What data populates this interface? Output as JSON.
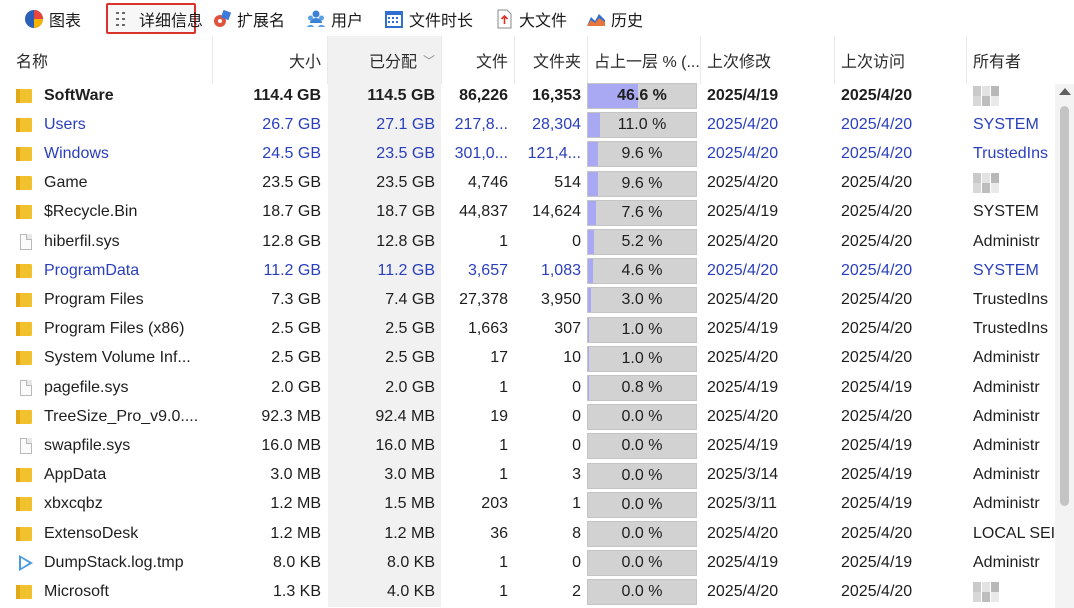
{
  "toolbar": {
    "tabs": [
      {
        "label": "图表",
        "icon": "pie-chart-icon",
        "active": false
      },
      {
        "label": "详细信息",
        "icon": "details-list-icon",
        "active": true
      },
      {
        "label": "扩展名",
        "icon": "extensions-icon",
        "active": false
      },
      {
        "label": "用户",
        "icon": "users-icon",
        "active": false
      },
      {
        "label": "文件时长",
        "icon": "calendar-icon",
        "active": false
      },
      {
        "label": "大文件",
        "icon": "big-file-icon",
        "active": false
      },
      {
        "label": "历史",
        "icon": "history-chart-icon",
        "active": false
      }
    ],
    "active_outline_color": "#d9342b"
  },
  "table": {
    "columns": {
      "name": "名称",
      "size": "大小",
      "allocated": "已分配",
      "files": "文件",
      "folders": "文件夹",
      "percent": "占上一层 % (...",
      "modified": "上次修改",
      "accessed": "上次访问",
      "owner": "所有者"
    },
    "sort_column": "allocated",
    "sort_indicator": "chevron-down-icon",
    "colors": {
      "blue_text": "#2a3fbd",
      "bar_fill": "#a9a9f3",
      "bar_track": "#d2d2d2"
    },
    "rows": [
      {
        "name": "SoftWare",
        "icon": "folder-icon",
        "size": "114.4 GB",
        "allocated": "114.5 GB",
        "files": "86,226",
        "folders": "16,353",
        "percent_text": "46.6 %",
        "percent": 46.6,
        "modified": "2025/4/19",
        "accessed": "2025/4/20",
        "owner": "",
        "owner_blurred": true,
        "bold": true,
        "blue": false
      },
      {
        "name": "Users",
        "icon": "folder-icon",
        "size": "26.7 GB",
        "allocated": "27.1 GB",
        "files": "217,8...",
        "folders": "28,304",
        "percent_text": "11.0 %",
        "percent": 11.0,
        "modified": "2025/4/20",
        "accessed": "2025/4/20",
        "owner": "SYSTEM",
        "owner_blurred": false,
        "bold": false,
        "blue": true
      },
      {
        "name": "Windows",
        "icon": "folder-icon",
        "size": "24.5 GB",
        "allocated": "23.5 GB",
        "files": "301,0...",
        "folders": "121,4...",
        "percent_text": "9.6 %",
        "percent": 9.6,
        "modified": "2025/4/20",
        "accessed": "2025/4/20",
        "owner": "TrustedIns",
        "owner_blurred": false,
        "bold": false,
        "blue": true
      },
      {
        "name": "Game",
        "icon": "folder-icon",
        "size": "23.5 GB",
        "allocated": "23.5 GB",
        "files": "4,746",
        "folders": "514",
        "percent_text": "9.6 %",
        "percent": 9.6,
        "modified": "2025/4/20",
        "accessed": "2025/4/20",
        "owner": "",
        "owner_blurred": true,
        "bold": false,
        "blue": false
      },
      {
        "name": "$Recycle.Bin",
        "icon": "folder-icon",
        "size": "18.7 GB",
        "allocated": "18.7 GB",
        "files": "44,837",
        "folders": "14,624",
        "percent_text": "7.6 %",
        "percent": 7.6,
        "modified": "2025/4/19",
        "accessed": "2025/4/20",
        "owner": "SYSTEM",
        "owner_blurred": false,
        "bold": false,
        "blue": false
      },
      {
        "name": "hiberfil.sys",
        "icon": "file-icon",
        "size": "12.8 GB",
        "allocated": "12.8 GB",
        "files": "1",
        "folders": "0",
        "percent_text": "5.2 %",
        "percent": 5.2,
        "modified": "2025/4/20",
        "accessed": "2025/4/20",
        "owner": "Administr",
        "owner_blurred": false,
        "bold": false,
        "blue": false
      },
      {
        "name": "ProgramData",
        "icon": "folder-icon",
        "size": "11.2 GB",
        "allocated": "11.2 GB",
        "files": "3,657",
        "folders": "1,083",
        "percent_text": "4.6 %",
        "percent": 4.6,
        "modified": "2025/4/20",
        "accessed": "2025/4/20",
        "owner": "SYSTEM",
        "owner_blurred": false,
        "bold": false,
        "blue": true
      },
      {
        "name": "Program Files",
        "icon": "folder-icon",
        "size": "7.3 GB",
        "allocated": "7.4 GB",
        "files": "27,378",
        "folders": "3,950",
        "percent_text": "3.0 %",
        "percent": 3.0,
        "modified": "2025/4/20",
        "accessed": "2025/4/20",
        "owner": "TrustedIns",
        "owner_blurred": false,
        "bold": false,
        "blue": false
      },
      {
        "name": "Program Files (x86)",
        "icon": "folder-icon",
        "size": "2.5 GB",
        "allocated": "2.5 GB",
        "files": "1,663",
        "folders": "307",
        "percent_text": "1.0 %",
        "percent": 1.0,
        "modified": "2025/4/19",
        "accessed": "2025/4/20",
        "owner": "TrustedIns",
        "owner_blurred": false,
        "bold": false,
        "blue": false
      },
      {
        "name": "System Volume Inf...",
        "icon": "folder-icon",
        "size": "2.5 GB",
        "allocated": "2.5 GB",
        "files": "17",
        "folders": "10",
        "percent_text": "1.0 %",
        "percent": 1.0,
        "modified": "2025/4/20",
        "accessed": "2025/4/20",
        "owner": "Administr",
        "owner_blurred": false,
        "bold": false,
        "blue": false
      },
      {
        "name": "pagefile.sys",
        "icon": "file-icon",
        "size": "2.0 GB",
        "allocated": "2.0 GB",
        "files": "1",
        "folders": "0",
        "percent_text": "0.8 %",
        "percent": 0.8,
        "modified": "2025/4/19",
        "accessed": "2025/4/19",
        "owner": "Administr",
        "owner_blurred": false,
        "bold": false,
        "blue": false
      },
      {
        "name": "TreeSize_Pro_v9.0....",
        "icon": "folder-icon",
        "size": "92.3 MB",
        "allocated": "92.4 MB",
        "files": "19",
        "folders": "0",
        "percent_text": "0.0 %",
        "percent": 0.0,
        "modified": "2025/4/20",
        "accessed": "2025/4/20",
        "owner": "Administr",
        "owner_blurred": false,
        "bold": false,
        "blue": false
      },
      {
        "name": "swapfile.sys",
        "icon": "file-icon",
        "size": "16.0 MB",
        "allocated": "16.0 MB",
        "files": "1",
        "folders": "0",
        "percent_text": "0.0 %",
        "percent": 0.0,
        "modified": "2025/4/19",
        "accessed": "2025/4/19",
        "owner": "Administr",
        "owner_blurred": false,
        "bold": false,
        "blue": false
      },
      {
        "name": "AppData",
        "icon": "folder-icon",
        "size": "3.0 MB",
        "allocated": "3.0 MB",
        "files": "1",
        "folders": "3",
        "percent_text": "0.0 %",
        "percent": 0.0,
        "modified": "2025/3/14",
        "accessed": "2025/4/19",
        "owner": "Administr",
        "owner_blurred": false,
        "bold": false,
        "blue": false
      },
      {
        "name": "xbxcqbz",
        "icon": "folder-icon",
        "size": "1.2 MB",
        "allocated": "1.5 MB",
        "files": "203",
        "folders": "1",
        "percent_text": "0.0 %",
        "percent": 0.0,
        "modified": "2025/3/11",
        "accessed": "2025/4/19",
        "owner": "Administr",
        "owner_blurred": false,
        "bold": false,
        "blue": false
      },
      {
        "name": "ExtensoDesk",
        "icon": "folder-icon",
        "size": "1.2 MB",
        "allocated": "1.2 MB",
        "files": "36",
        "folders": "8",
        "percent_text": "0.0 %",
        "percent": 0.0,
        "modified": "2025/4/20",
        "accessed": "2025/4/20",
        "owner": "LOCAL SEI",
        "owner_blurred": false,
        "bold": false,
        "blue": false
      },
      {
        "name": "DumpStack.log.tmp",
        "icon": "play-icon",
        "size": "8.0 KB",
        "allocated": "8.0 KB",
        "files": "1",
        "folders": "0",
        "percent_text": "0.0 %",
        "percent": 0.0,
        "modified": "2025/4/19",
        "accessed": "2025/4/19",
        "owner": "Administr",
        "owner_blurred": false,
        "bold": false,
        "blue": false
      },
      {
        "name": "Microsoft",
        "icon": "folder-icon",
        "size": "1.3 KB",
        "allocated": "4.0 KB",
        "files": "1",
        "folders": "2",
        "percent_text": "0.0 %",
        "percent": 0.0,
        "modified": "2025/4/20",
        "accessed": "2025/4/20",
        "owner": "",
        "owner_blurred": true,
        "bold": false,
        "blue": false
      }
    ]
  }
}
